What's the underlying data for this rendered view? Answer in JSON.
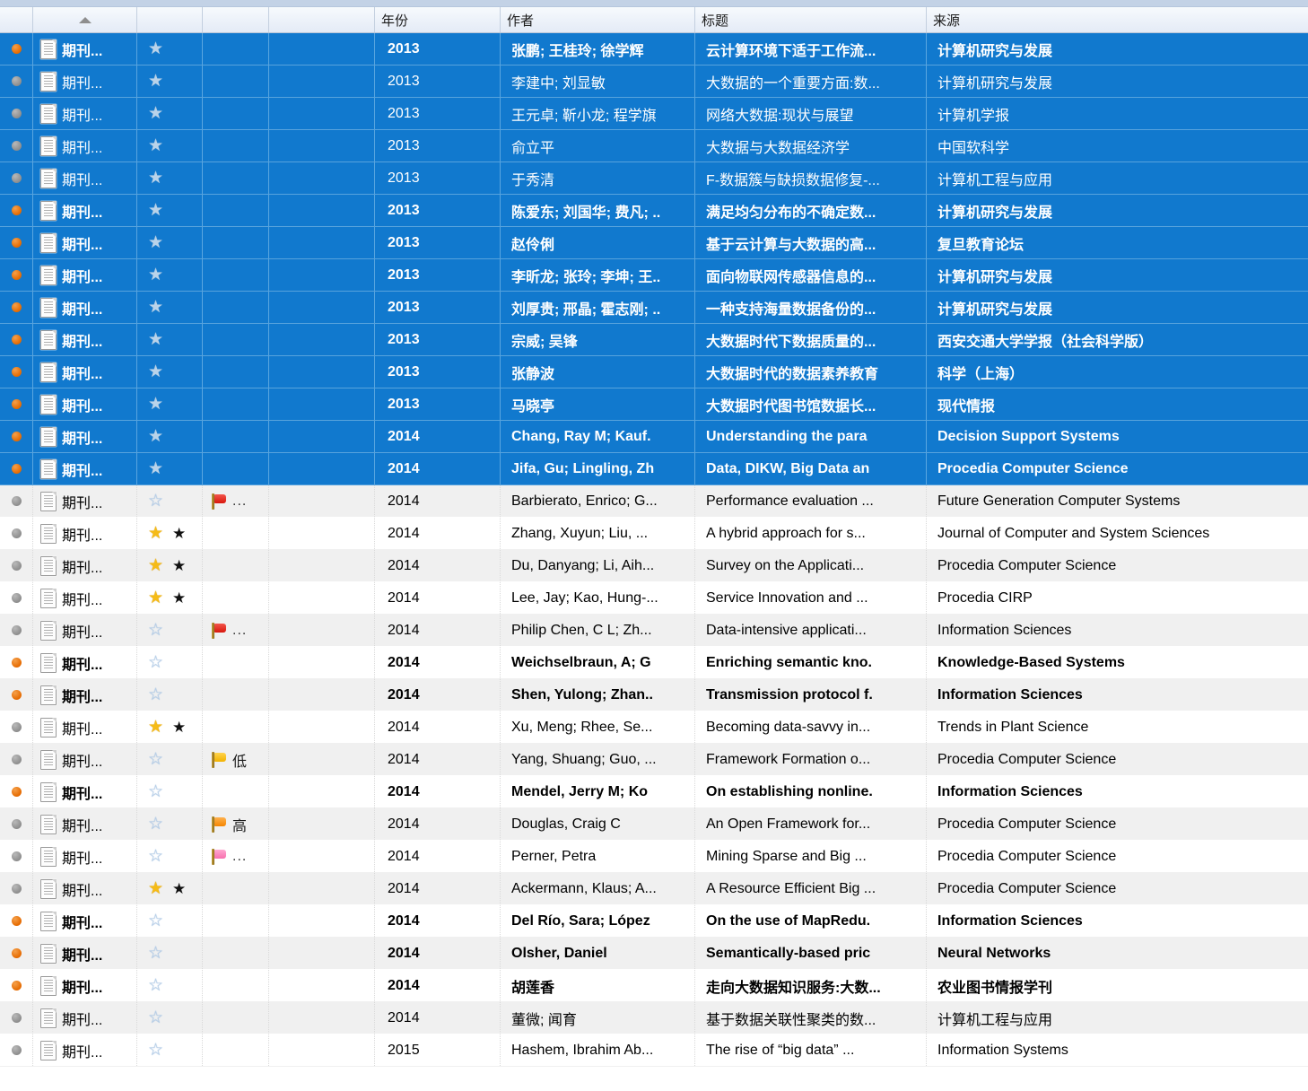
{
  "window": {
    "title": "Reference list table",
    "accent_selected": "#1179ce",
    "alt_row_color": "#f0f0f0",
    "header_bg": "#eef3fa"
  },
  "table": {
    "columns": [
      {
        "key": "dot",
        "label": "",
        "name": "read-status-column"
      },
      {
        "key": "type",
        "label": "",
        "name": "reference-type-column",
        "sorted": true,
        "sort_direction": "asc"
      },
      {
        "key": "star",
        "label": "",
        "name": "rating-column"
      },
      {
        "key": "flag",
        "label": "",
        "name": "priority-flag-column"
      },
      {
        "key": "extra",
        "label": "",
        "name": "extra-column"
      },
      {
        "key": "year",
        "label": "年份",
        "name": "year-column"
      },
      {
        "key": "author",
        "label": "作者",
        "name": "author-column"
      },
      {
        "key": "title",
        "label": "标题",
        "name": "title-column"
      },
      {
        "key": "source",
        "label": "来源",
        "name": "source-column"
      }
    ],
    "rows": [
      {
        "selected": true,
        "bold": true,
        "dot": "read",
        "type": "期刊...",
        "star": "empty-on-sel",
        "black_star": false,
        "flag": null,
        "flag_label": "",
        "year": "2013",
        "author": "张鹏; 王桂玲; 徐学辉",
        "title": "云计算环境下适于工作流...",
        "source": "计算机研究与发展"
      },
      {
        "selected": true,
        "bold": false,
        "dot": "unread",
        "type": "期刊...",
        "star": "empty-on-sel",
        "black_star": false,
        "flag": null,
        "flag_label": "",
        "year": "2013",
        "author": "李建中; 刘显敏",
        "title": "大数据的一个重要方面:数...",
        "source": "计算机研究与发展"
      },
      {
        "selected": true,
        "bold": false,
        "dot": "unread",
        "type": "期刊...",
        "star": "empty-on-sel",
        "black_star": false,
        "flag": null,
        "flag_label": "",
        "year": "2013",
        "author": "王元卓; 靳小龙; 程学旗",
        "title": "网络大数据:现状与展望",
        "source": "计算机学报"
      },
      {
        "selected": true,
        "bold": false,
        "dot": "unread",
        "type": "期刊...",
        "star": "empty-on-sel",
        "black_star": false,
        "flag": null,
        "flag_label": "",
        "year": "2013",
        "author": "俞立平",
        "title": "大数据与大数据经济学",
        "source": "中国软科学"
      },
      {
        "selected": true,
        "bold": false,
        "dot": "unread",
        "type": "期刊...",
        "star": "empty-on-sel",
        "black_star": false,
        "flag": null,
        "flag_label": "",
        "year": "2013",
        "author": "于秀清",
        "title": "F-数据簇与缺损数据修复-...",
        "source": "计算机工程与应用"
      },
      {
        "selected": true,
        "bold": true,
        "dot": "read",
        "type": "期刊...",
        "star": "empty-on-sel",
        "black_star": false,
        "flag": null,
        "flag_label": "",
        "year": "2013",
        "author": "陈爱东; 刘国华; 费凡; ..",
        "title": "满足均匀分布的不确定数...",
        "source": "计算机研究与发展"
      },
      {
        "selected": true,
        "bold": true,
        "dot": "read",
        "type": "期刊...",
        "star": "empty-on-sel",
        "black_star": false,
        "flag": null,
        "flag_label": "",
        "year": "2013",
        "author": "赵伶俐",
        "title": "基于云计算与大数据的高...",
        "source": "复旦教育论坛"
      },
      {
        "selected": true,
        "bold": true,
        "dot": "read",
        "type": "期刊...",
        "star": "empty-on-sel",
        "black_star": false,
        "flag": null,
        "flag_label": "",
        "year": "2013",
        "author": "李昕龙; 张玲; 李坤; 王..",
        "title": "面向物联网传感器信息的...",
        "source": "计算机研究与发展"
      },
      {
        "selected": true,
        "bold": true,
        "dot": "read",
        "type": "期刊...",
        "star": "empty-on-sel",
        "black_star": false,
        "flag": null,
        "flag_label": "",
        "year": "2013",
        "author": "刘厚贵; 邢晶; 霍志刚; ..",
        "title": "一种支持海量数据备份的...",
        "source": "计算机研究与发展"
      },
      {
        "selected": true,
        "bold": true,
        "dot": "read",
        "type": "期刊...",
        "star": "empty-on-sel",
        "black_star": false,
        "flag": null,
        "flag_label": "",
        "year": "2013",
        "author": "宗威; 吴锋",
        "title": "大数据时代下数据质量的...",
        "source": "西安交通大学学报（社会科学版）"
      },
      {
        "selected": true,
        "bold": true,
        "dot": "read",
        "type": "期刊...",
        "star": "empty-on-sel",
        "black_star": false,
        "flag": null,
        "flag_label": "",
        "year": "2013",
        "author": "张静波",
        "title": "大数据时代的数据素养教育",
        "source": "科学（上海）"
      },
      {
        "selected": true,
        "bold": true,
        "dot": "read",
        "type": "期刊...",
        "star": "empty-on-sel",
        "black_star": false,
        "flag": null,
        "flag_label": "",
        "year": "2013",
        "author": "马晓亭",
        "title": "大数据时代图书馆数据长...",
        "source": "现代情报"
      },
      {
        "selected": true,
        "bold": true,
        "dot": "read",
        "type": "期刊...",
        "star": "empty-on-sel",
        "black_star": false,
        "flag": null,
        "flag_label": "",
        "year": "2014",
        "author": "Chang, Ray M; Kauf.",
        "title": "Understanding the para",
        "source": "Decision Support Systems"
      },
      {
        "selected": true,
        "bold": true,
        "dot": "read",
        "type": "期刊...",
        "star": "empty-on-sel",
        "black_star": false,
        "flag": null,
        "flag_label": "",
        "year": "2014",
        "author": "Jifa, Gu; Lingling, Zh",
        "title": "Data, DIKW, Big Data an",
        "source": "Procedia Computer Science"
      },
      {
        "selected": false,
        "bold": false,
        "dot": "unread",
        "type": "期刊...",
        "star": "empty",
        "black_star": false,
        "flag": "red",
        "flag_label": "...",
        "year": "2014",
        "author": "Barbierato, Enrico; G...",
        "title": "Performance evaluation ...",
        "source": "Future Generation Computer Systems"
      },
      {
        "selected": false,
        "bold": false,
        "dot": "unread",
        "type": "期刊...",
        "star": "gold",
        "black_star": true,
        "flag": null,
        "flag_label": "",
        "year": "2014",
        "author": "Zhang, Xuyun; Liu, ...",
        "title": "A hybrid approach for s...",
        "source": "Journal of Computer and System Sciences"
      },
      {
        "selected": false,
        "bold": false,
        "dot": "unread",
        "type": "期刊...",
        "star": "gold",
        "black_star": true,
        "flag": null,
        "flag_label": "",
        "year": "2014",
        "author": "Du, Danyang; Li, Aih...",
        "title": "Survey on the Applicati...",
        "source": "Procedia Computer Science"
      },
      {
        "selected": false,
        "bold": false,
        "dot": "unread",
        "type": "期刊...",
        "star": "gold",
        "black_star": true,
        "flag": null,
        "flag_label": "",
        "year": "2014",
        "author": "Lee, Jay; Kao, Hung-...",
        "title": "Service Innovation and ...",
        "source": "Procedia CIRP"
      },
      {
        "selected": false,
        "bold": false,
        "dot": "unread",
        "type": "期刊...",
        "star": "empty",
        "black_star": false,
        "flag": "red",
        "flag_label": "...",
        "year": "2014",
        "author": "Philip Chen, C L; Zh...",
        "title": "Data-intensive applicati...",
        "source": "Information Sciences"
      },
      {
        "selected": false,
        "bold": true,
        "dot": "read",
        "type": "期刊...",
        "star": "empty",
        "black_star": false,
        "flag": null,
        "flag_label": "",
        "year": "2014",
        "author": "Weichselbraun, A; G",
        "title": "Enriching semantic kno.",
        "source": "Knowledge-Based Systems"
      },
      {
        "selected": false,
        "bold": true,
        "dot": "read",
        "type": "期刊...",
        "star": "empty",
        "black_star": false,
        "flag": null,
        "flag_label": "",
        "year": "2014",
        "author": "Shen, Yulong; Zhan..",
        "title": "Transmission protocol f.",
        "source": "Information Sciences"
      },
      {
        "selected": false,
        "bold": false,
        "dot": "unread",
        "type": "期刊...",
        "star": "gold",
        "black_star": true,
        "flag": null,
        "flag_label": "",
        "year": "2014",
        "author": "Xu, Meng; Rhee, Se...",
        "title": "Becoming data-savvy in...",
        "source": "Trends in Plant Science"
      },
      {
        "selected": false,
        "bold": false,
        "dot": "unread",
        "type": "期刊...",
        "star": "empty",
        "black_star": false,
        "flag": "yellow",
        "flag_label": "低",
        "year": "2014",
        "author": "Yang, Shuang; Guo, ...",
        "title": "Framework Formation o...",
        "source": "Procedia Computer Science"
      },
      {
        "selected": false,
        "bold": true,
        "dot": "read",
        "type": "期刊...",
        "star": "empty",
        "black_star": false,
        "flag": null,
        "flag_label": "",
        "year": "2014",
        "author": "Mendel, Jerry M; Ko",
        "title": "On establishing nonline.",
        "source": "Information Sciences"
      },
      {
        "selected": false,
        "bold": false,
        "dot": "unread",
        "type": "期刊...",
        "star": "empty",
        "black_star": false,
        "flag": "orange",
        "flag_label": "高",
        "year": "2014",
        "author": "Douglas, Craig C",
        "title": "An Open Framework for...",
        "source": "Procedia Computer Science"
      },
      {
        "selected": false,
        "bold": false,
        "dot": "unread",
        "type": "期刊...",
        "star": "empty",
        "black_star": false,
        "flag": "pink",
        "flag_label": "...",
        "year": "2014",
        "author": "Perner, Petra",
        "title": "Mining Sparse and Big ...",
        "source": "Procedia Computer Science"
      },
      {
        "selected": false,
        "bold": false,
        "dot": "unread",
        "type": "期刊...",
        "star": "gold",
        "black_star": true,
        "flag": null,
        "flag_label": "",
        "year": "2014",
        "author": "Ackermann, Klaus; A...",
        "title": "A Resource Efficient Big ...",
        "source": "Procedia Computer Science"
      },
      {
        "selected": false,
        "bold": true,
        "dot": "read",
        "type": "期刊...",
        "star": "empty",
        "black_star": false,
        "flag": null,
        "flag_label": "",
        "year": "2014",
        "author": "Del Río, Sara; López",
        "title": "On the use of MapRedu.",
        "source": "Information Sciences"
      },
      {
        "selected": false,
        "bold": true,
        "dot": "read",
        "type": "期刊...",
        "star": "empty",
        "black_star": false,
        "flag": null,
        "flag_label": "",
        "year": "2014",
        "author": "Olsher, Daniel",
        "title": "Semantically-based pric",
        "source": "Neural Networks"
      },
      {
        "selected": false,
        "bold": true,
        "dot": "read",
        "type": "期刊...",
        "star": "empty",
        "black_star": false,
        "flag": null,
        "flag_label": "",
        "year": "2014",
        "author": "胡莲香",
        "title": "走向大数据知识服务:大数...",
        "source": "农业图书情报学刊"
      },
      {
        "selected": false,
        "bold": false,
        "dot": "unread",
        "type": "期刊...",
        "star": "empty",
        "black_star": false,
        "flag": null,
        "flag_label": "",
        "year": "2014",
        "author": "董微; 闻育",
        "title": "基于数据关联性聚类的数...",
        "source": "计算机工程与应用"
      },
      {
        "selected": false,
        "bold": false,
        "dot": "unread",
        "type": "期刊...",
        "star": "empty",
        "black_star": false,
        "flag": null,
        "flag_label": "",
        "year": "2015",
        "author": "Hashem, Ibrahim Ab...",
        "title": "The rise of “big data” ...",
        "source": "Information Systems"
      }
    ]
  }
}
